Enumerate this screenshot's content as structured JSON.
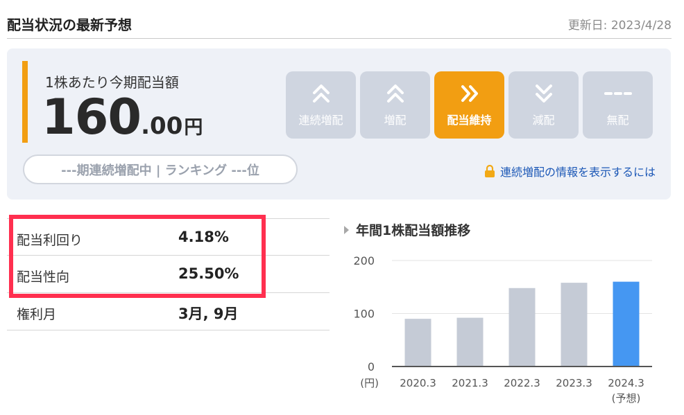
{
  "header": {
    "title": "配当状況の最新予想",
    "updated": "更新日: 2023/4/28"
  },
  "dividend": {
    "label": "1株あたり今期配当額",
    "amount_int": "160",
    "amount_dec": ".00",
    "unit": "円"
  },
  "status_buttons": [
    {
      "label": "連続増配",
      "icon": "double-chevron-up-icon",
      "active": false
    },
    {
      "label": "増配",
      "icon": "double-chevron-up-icon",
      "active": false
    },
    {
      "label": "配当維持",
      "icon": "double-chevron-right-icon",
      "active": true
    },
    {
      "label": "減配",
      "icon": "double-chevron-down-icon",
      "active": false
    },
    {
      "label": "無配",
      "icon": "dashes-icon",
      "active": false
    }
  ],
  "streak": {
    "text": "---期連続増配中 | ランキング ---位"
  },
  "lock_link": {
    "text": "連続増配の情報を表示するには",
    "icon": "lock-icon"
  },
  "stats": [
    {
      "label": "配当利回り",
      "value": "4.18%"
    },
    {
      "label": "配当性向",
      "value": "25.50%"
    },
    {
      "label": "権利月",
      "value": "3月, 9月"
    }
  ],
  "chart_title": "年間1株配当額推移",
  "chart_data": {
    "type": "bar",
    "title": "年間1株配当額推移",
    "categories": [
      "2020.3",
      "2021.3",
      "2022.3",
      "2023.3",
      "2024.3"
    ],
    "category_sublabels": [
      "",
      "",
      "",
      "",
      "(予想)"
    ],
    "values": [
      90,
      92,
      148,
      158,
      160
    ],
    "ylim": [
      0,
      200
    ],
    "yticks": [
      0,
      100,
      200
    ],
    "yunit": "(円)",
    "bar_colors": [
      "#c5cbd6",
      "#c5cbd6",
      "#c5cbd6",
      "#c5cbd6",
      "#4597f2"
    ],
    "grid": true
  },
  "colors": {
    "accent": "#f29e12",
    "highlight_border": "#ff2f4f",
    "link": "#1b57b6",
    "forecast_bar": "#4597f2",
    "past_bar": "#c5cbd6"
  }
}
